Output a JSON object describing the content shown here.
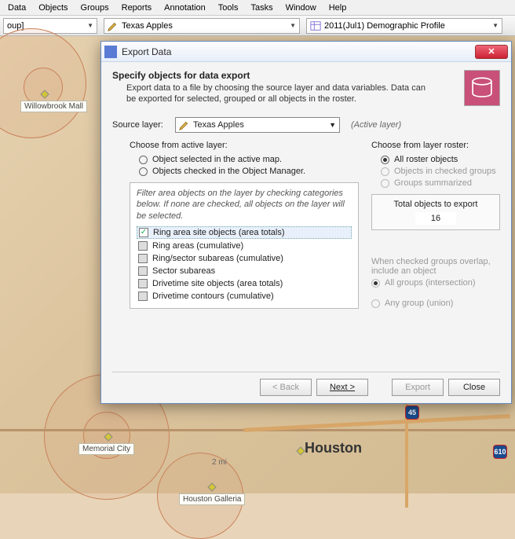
{
  "menu": [
    "Data",
    "Objects",
    "Groups",
    "Reports",
    "Annotation",
    "Tools",
    "Tasks",
    "Window",
    "Help"
  ],
  "toolbar": {
    "drop1": "oup]",
    "drop2": "Texas Apples",
    "drop3": "2011(Jul1) Demographic Profile"
  },
  "map": {
    "labels": {
      "willowbrook": "Willowbrook Mall",
      "memorial": "Memorial City",
      "galleria": "Houston Galleria",
      "scale": "2 mi"
    },
    "city": "Houston",
    "shields": {
      "i45": "45",
      "i610": "610"
    }
  },
  "dialog": {
    "title": "Export Data",
    "h1": "Specify objects for data export",
    "h2a": "Export data to a file by choosing the source layer and data variables. Data can",
    "h2b": "be exported for selected, grouped or all objects in the roster.",
    "src_label": "Source layer:",
    "src_value": "Texas Apples",
    "active": "(Active layer)",
    "choose_active": "Choose from active layer:",
    "ra1": "Object selected in the active map.",
    "ra2": "Objects checked in the Object Manager.",
    "choose_roster": "Choose from layer roster:",
    "rr1": "All roster objects",
    "rr2": "Objects in checked groups",
    "rr3": "Groups summarized",
    "filter_hint": "Filter area objects on the layer by checking categories below. If none are checked, all objects on the layer will be selected.",
    "f1": "Ring area site objects (area totals)",
    "f2": "Ring areas (cumulative)",
    "f3": "Ring/sector subareas (cumulative)",
    "f4": "Sector subareas",
    "f5": "Drivetime site objects (area totals)",
    "f6": "Drivetime contours (cumulative)",
    "total_label": "Total objects to export",
    "total_value": "16",
    "overlap_hint": "When checked groups overlap, include an object",
    "ov1": "All groups (intersection)",
    "ov2": "Any group (union)",
    "btn_back": "< Back",
    "btn_next": "Next >",
    "btn_export": "Export",
    "btn_close": "Close"
  }
}
